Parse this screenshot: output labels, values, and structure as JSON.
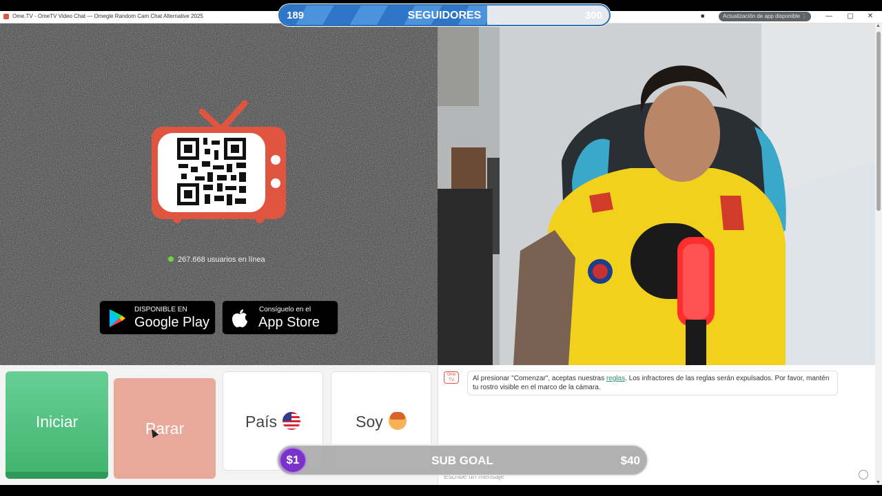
{
  "window": {
    "title": "Ome.TV - OmeTV Video Chat — Omegle Random Cam Chat Alternative 2025",
    "update_badge": "Actualización de app disponible",
    "menu_icon": "⋮",
    "camera_icon": "camera-icon",
    "minimize": "—",
    "maximize": "▢",
    "close": "✕"
  },
  "overlay_top": {
    "left": "189",
    "center": "SEGUIDORES",
    "right": "300",
    "progress": 0.63,
    "accent": "#2d76c7"
  },
  "left": {
    "online_text": "267.668 usuarios en línea",
    "google_play": {
      "small": "DISPONIBLE EN",
      "large": "Google Play"
    },
    "app_store": {
      "small": "Consíguelo en el",
      "large": "App Store"
    }
  },
  "buttons": {
    "start": "Iniciar",
    "stop": "Parar",
    "country": "País",
    "gender": "Soy"
  },
  "chat": {
    "logo": "Ome TV",
    "notice_before": "Al presionar \"Comenzar\", aceptas nuestras ",
    "notice_link": "reglas",
    "notice_after": ". Los infractores de las reglas serán expulsados. Por favor, mantén tu rostro visible en el marco de la cámara.",
    "input_placeholder": "Escribe un mensaje"
  },
  "overlay_bottom": {
    "coin": "$1",
    "center": "SUB GOAL",
    "right": "$40"
  },
  "colors": {
    "start_green": "#4fc07f",
    "stop_pink": "#e8a99a",
    "brand": "#e0553f",
    "online_dot": "#6fd33a"
  }
}
